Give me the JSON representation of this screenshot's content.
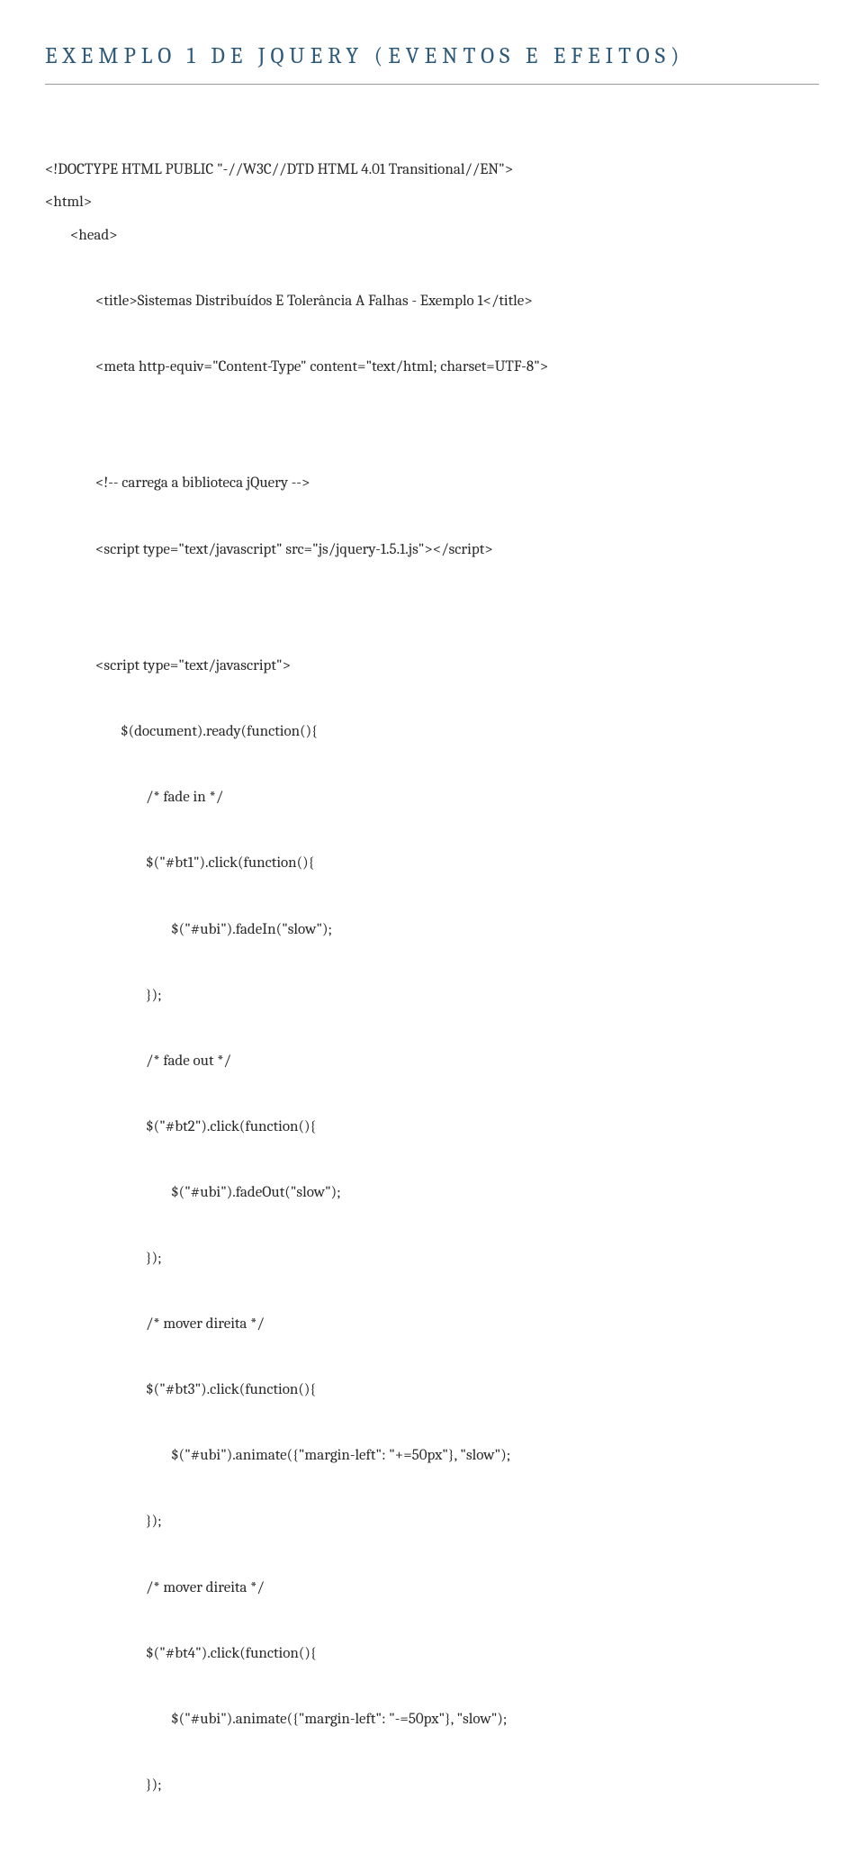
{
  "heading": "EXEMPLO 1 DE JQUERY (EVENTOS E EFEITOS)",
  "c": {
    "l1": "<!DOCTYPE HTML PUBLIC \"-//W3C//DTD HTML 4.01 Transitional//EN\">",
    "l2": "<html>",
    "l3": "<head>",
    "l4": "<title>Sistemas Distribuídos E Tolerância A Falhas - Exemplo 1</title>",
    "l5": "<meta http-equiv=\"Content-Type\" content=\"text/html; charset=UTF-8\">",
    "l6": "<!-- carrega a biblioteca jQuery -->",
    "l7": "<script type=\"text/javascript\" src=\"js/jquery-1.5.1.js\"></script>",
    "l8": "<script type=\"text/javascript\">",
    "l9": "$(document).ready(function(){",
    "l10": "/* fade in */",
    "l11": "$(\"#bt1\").click(function(){",
    "l12": "$(\"#ubi\").fadeIn(\"slow\");",
    "l13": "});",
    "l14": "/* fade out */",
    "l15": "$(\"#bt2\").click(function(){",
    "l16": "$(\"#ubi\").fadeOut(\"slow\");",
    "l17": "});",
    "l18": "/* mover direita */",
    "l19": "$(\"#bt3\").click(function(){",
    "l20": "$(\"#ubi\").animate({\"margin-left\": \"+=50px\"}, \"slow\");",
    "l21": "});",
    "l22": "/* mover direita */",
    "l23": "$(\"#bt4\").click(function(){",
    "l24": "$(\"#ubi\").animate({\"margin-left\": \"-=50px\"}, \"slow\");",
    "l25": "});"
  }
}
